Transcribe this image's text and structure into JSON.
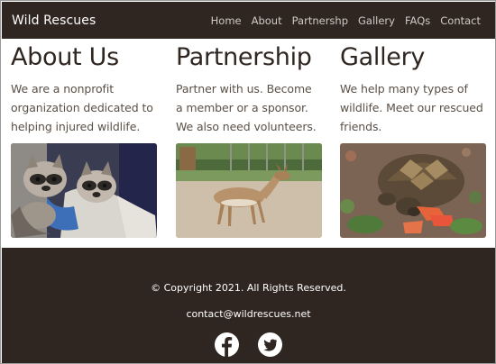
{
  "nav": {
    "brand": "Wild Rescues",
    "links": [
      "Home",
      "About",
      "Partnershp",
      "Gallery",
      "FAQs",
      "Contact"
    ]
  },
  "sections": [
    {
      "title": "About Us",
      "text": "We are a nonprofit organization dedicated to helping injured wildlife.",
      "image": "raccoon-kits-photo"
    },
    {
      "title": "Partnership",
      "text": "Partner with us. Become a member or a sponsor. We also need volunteers.",
      "image": "deer-photo"
    },
    {
      "title": "Gallery",
      "text": "We help many types of wildlife. Meet our rescued friends.",
      "image": "tortoise-photo"
    }
  ],
  "footer": {
    "copyright": "© Copyright 2021. All Rights Reserved.",
    "email": "contact@wildrescues.net",
    "social": [
      "facebook-icon",
      "twitter-icon"
    ]
  },
  "colors": {
    "dark": "#2f2621",
    "nav_link": "#cfc9c4",
    "body_text": "#5a5047"
  }
}
